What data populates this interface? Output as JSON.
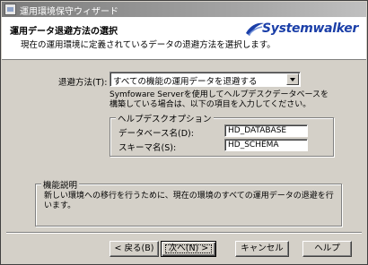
{
  "window": {
    "title": "運用環境保守ウィザード"
  },
  "header": {
    "title": "運用データ退避方法の選択",
    "subtitle": "現在の運用環境に定義されているデータの退避方法を選択します。",
    "logo": "Systemwalker",
    "logo_color": "#1b3fa8"
  },
  "method": {
    "label": "退避方法(T):",
    "selected": "すべての機能の運用データを退避する"
  },
  "description": "Symfoware Serverを使用してヘルプデスクデータベースを構築している場合は、以下の項目を入力してください。",
  "help_desk": {
    "group_label": "ヘルプデスクオプション",
    "db_name_label": "データベース名(D):",
    "db_name_value": "HD_DATABASE",
    "schema_label": "スキーマ名(S):",
    "schema_value": "HD_SCHEMA"
  },
  "function": {
    "group_label": "機能説明",
    "text": "新しい環境への移行を行うために、現在の環境のすべての運用データの退避を行います。"
  },
  "buttons": {
    "back": "< 戻る(B)",
    "next": "次へ(N) >",
    "cancel": "キャンセル",
    "help": "ヘルプ"
  }
}
